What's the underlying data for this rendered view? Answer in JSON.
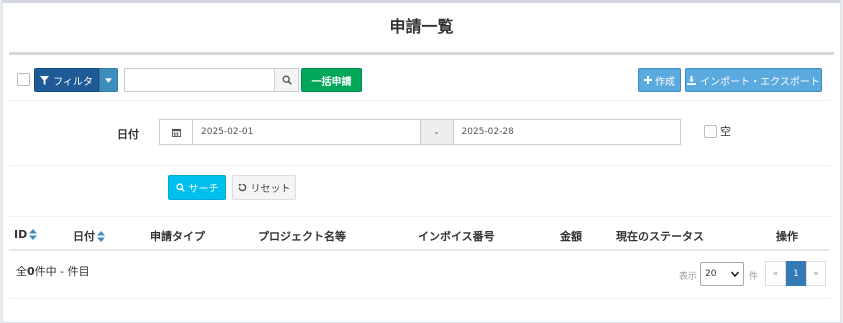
{
  "page": {
    "title": "申請一覧"
  },
  "toolbar": {
    "filter_label": "フィルタ",
    "search_value": "",
    "bulk_label": "一括申請",
    "create_label": "作成",
    "import_export_label": "インポート・エクスポート",
    "icons": {
      "filter": "filter-icon",
      "caret": "caret-down-icon",
      "search": "search-icon",
      "plus": "plus-icon",
      "download": "download-icon"
    }
  },
  "filter": {
    "date_label": "日付",
    "date_from": "2025-02-01",
    "date_sep": "-",
    "date_to": "2025-02-28",
    "empty_label": "空",
    "search_label": "サーチ",
    "reset_label": "リセット"
  },
  "table": {
    "columns": [
      "ID",
      "日付",
      "申請タイプ",
      "プロジェクト名等",
      "インボイス番号",
      "金額",
      "現在のステータス",
      "操作"
    ],
    "rows": []
  },
  "footer": {
    "count_prefix": "全",
    "count_value": "0",
    "count_suffix": "件中 - 件目",
    "display_label": "表示",
    "page_size": "20",
    "page_size_suffix": "件",
    "prev": "«",
    "current_page": "1",
    "next": "»"
  },
  "colors": {
    "filter": "#1e5a96",
    "green": "#00a65a",
    "aqua": "#00c0ef",
    "page_active": "#337ab7"
  }
}
